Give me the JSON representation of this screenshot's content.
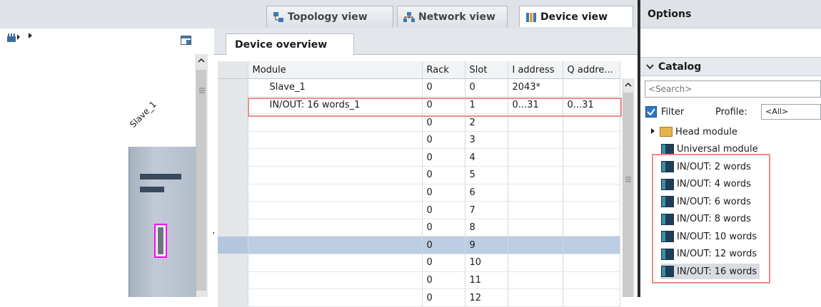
{
  "views": {
    "topology": "Topology view",
    "network": "Network view",
    "device": "Device view"
  },
  "device": {
    "label": "Slave_1",
    "frame_color": "#ff00ff"
  },
  "overview": {
    "tab": "Device overview",
    "columns": [
      "Module",
      "Rack",
      "Slot",
      "I address",
      "Q addre..."
    ],
    "rows": [
      {
        "module": "Slave_1",
        "rack": "0",
        "slot": "0",
        "iaddr": "2043*",
        "qaddr": ""
      },
      {
        "module": "IN/OUT: 16 words_1",
        "rack": "0",
        "slot": "1",
        "iaddr": "0...31",
        "qaddr": "0...31"
      },
      {
        "module": "",
        "rack": "0",
        "slot": "2",
        "iaddr": "",
        "qaddr": ""
      },
      {
        "module": "",
        "rack": "0",
        "slot": "3",
        "iaddr": "",
        "qaddr": ""
      },
      {
        "module": "",
        "rack": "0",
        "slot": "4",
        "iaddr": "",
        "qaddr": ""
      },
      {
        "module": "",
        "rack": "0",
        "slot": "5",
        "iaddr": "",
        "qaddr": ""
      },
      {
        "module": "",
        "rack": "0",
        "slot": "6",
        "iaddr": "",
        "qaddr": ""
      },
      {
        "module": "",
        "rack": "0",
        "slot": "7",
        "iaddr": "",
        "qaddr": ""
      },
      {
        "module": "",
        "rack": "0",
        "slot": "8",
        "iaddr": "",
        "qaddr": ""
      },
      {
        "module": "",
        "rack": "0",
        "slot": "9",
        "iaddr": "",
        "qaddr": ""
      },
      {
        "module": "",
        "rack": "0",
        "slot": "10",
        "iaddr": "",
        "qaddr": ""
      },
      {
        "module": "",
        "rack": "0",
        "slot": "11",
        "iaddr": "",
        "qaddr": ""
      },
      {
        "module": "",
        "rack": "0",
        "slot": "12",
        "iaddr": "",
        "qaddr": ""
      }
    ],
    "selected_slot": "9",
    "highlight_color": "#f08a8a"
  },
  "options": {
    "title": "Options",
    "catalog": {
      "title": "Catalog",
      "search_placeholder": "<Search>",
      "filter_label": "Filter",
      "filter_checked": true,
      "profile_label": "Profile:",
      "profile_value": "<All>",
      "items": [
        {
          "label": "Head module",
          "icon": "folder-icon"
        },
        {
          "label": "Universal module",
          "icon": "module-icon"
        },
        {
          "label": "IN/OUT: 2 words",
          "icon": "module-icon"
        },
        {
          "label": "IN/OUT: 4 words",
          "icon": "module-icon"
        },
        {
          "label": "IN/OUT: 6 words",
          "icon": "module-icon"
        },
        {
          "label": "IN/OUT: 8 words",
          "icon": "module-icon"
        },
        {
          "label": "IN/OUT: 10 words",
          "icon": "module-icon"
        },
        {
          "label": "IN/OUT: 12 words",
          "icon": "module-icon"
        },
        {
          "label": "IN/OUT: 16 words",
          "icon": "module-icon"
        }
      ]
    }
  }
}
